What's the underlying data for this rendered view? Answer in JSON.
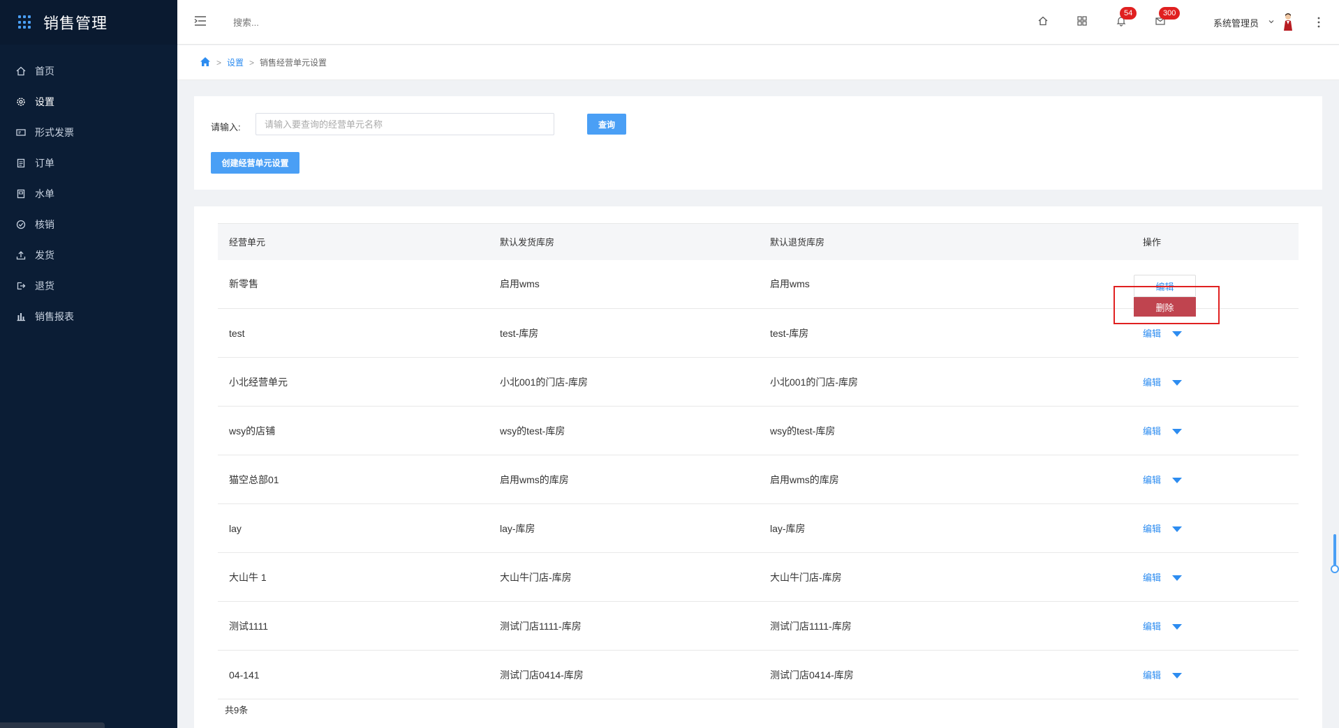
{
  "app": {
    "title": "销售管理"
  },
  "sidebar": {
    "items": [
      {
        "label": "首页",
        "icon": "home-icon"
      },
      {
        "label": "设置",
        "icon": "gear-icon"
      },
      {
        "label": "形式发票",
        "icon": "invoice-icon"
      },
      {
        "label": "订单",
        "icon": "order-icon"
      },
      {
        "label": "水单",
        "icon": "receipt-icon"
      },
      {
        "label": "核销",
        "icon": "check-circle-icon"
      },
      {
        "label": "发货",
        "icon": "upload-icon"
      },
      {
        "label": "退货",
        "icon": "return-icon"
      },
      {
        "label": "销售报表",
        "icon": "bar-chart-icon"
      }
    ]
  },
  "header": {
    "search_placeholder": "搜索...",
    "notifications_count": "54",
    "messages_count": "300",
    "user_name": "系统管理员"
  },
  "breadcrumb": {
    "level1": "设置",
    "level2": "销售经营单元设置"
  },
  "filter": {
    "label": "请输入:",
    "placeholder": "请输入要查询的经营单元名称",
    "query_button": "查询",
    "create_button": "创建经营单元设置"
  },
  "table": {
    "headers": [
      "经营单元",
      "默认发货库房",
      "默认退货库房",
      "操作"
    ],
    "rows": [
      {
        "unit": "新零售",
        "ship": "启用wms",
        "return": "启用wms",
        "edit": "编辑"
      },
      {
        "unit": "test",
        "ship": "test-库房",
        "return": "test-库房",
        "edit": "编辑"
      },
      {
        "unit": "小北经营单元",
        "ship": "小北001的门店-库房",
        "return": "小北001的门店-库房",
        "edit": "编辑"
      },
      {
        "unit": "wsy的店铺",
        "ship": "wsy的test-库房",
        "return": "wsy的test-库房",
        "edit": "编辑"
      },
      {
        "unit": "猫空总部01",
        "ship": "启用wms的库房",
        "return": "启用wms的库房",
        "edit": "编辑"
      },
      {
        "unit": "lay",
        "ship": "lay-库房",
        "return": "lay-库房",
        "edit": "编辑"
      },
      {
        "unit": "大山牛 1",
        "ship": "大山牛门店-库房",
        "return": "大山牛门店-库房",
        "edit": "编辑"
      },
      {
        "unit": "测试1111",
        "ship": "测试门店1111-库房",
        "return": "测试门店1111-库房",
        "edit": "编辑"
      },
      {
        "unit": "04-141",
        "ship": "测试门店0414-库房",
        "return": "测试门店0414-库房",
        "edit": "编辑"
      }
    ],
    "total": "共9条"
  },
  "dropdown": {
    "edit_label": "编辑",
    "delete_label": "删除"
  },
  "colors": {
    "sidebar_bg": "#0b1d35",
    "primary": "#4a9ff5",
    "link": "#2d8cf0",
    "delete_bg": "#c0444f",
    "badge": "#e02020"
  }
}
